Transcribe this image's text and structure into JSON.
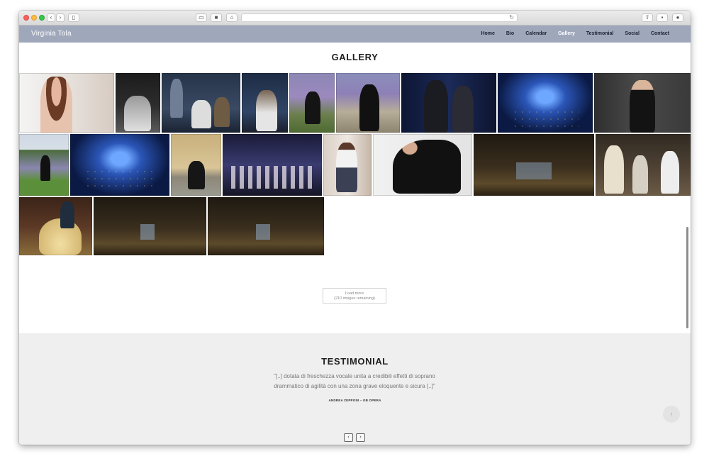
{
  "site": {
    "brand": "Virginia Tola",
    "nav": [
      "Home",
      "Bio",
      "Calendar",
      "Gallery",
      "Testimonial",
      "Social",
      "Contact"
    ],
    "active_nav": "Gallery"
  },
  "gallery": {
    "title": "GALLERY",
    "load_more_label": "Load more",
    "load_more_remaining": "(210 images remaining)"
  },
  "testimonial": {
    "title": "TESTIMONIAL",
    "quote_line1": "\"[..] dotata di freschezza vocale unita a credibili effetti di soprano",
    "quote_line2": "drammatico di agilità con una zona grave eloquente e sicura [..]\"",
    "author": "ANDREA ZEPPONI – GB OPERA",
    "prev_label": "‹",
    "next_label": "›"
  },
  "icons": {
    "back": "chevron-left-icon",
    "forward": "chevron-right-icon",
    "sidebar": "sidebar-icon",
    "reload": "reload-icon",
    "share": "share-icon",
    "to_top": "arrow-up-icon"
  }
}
